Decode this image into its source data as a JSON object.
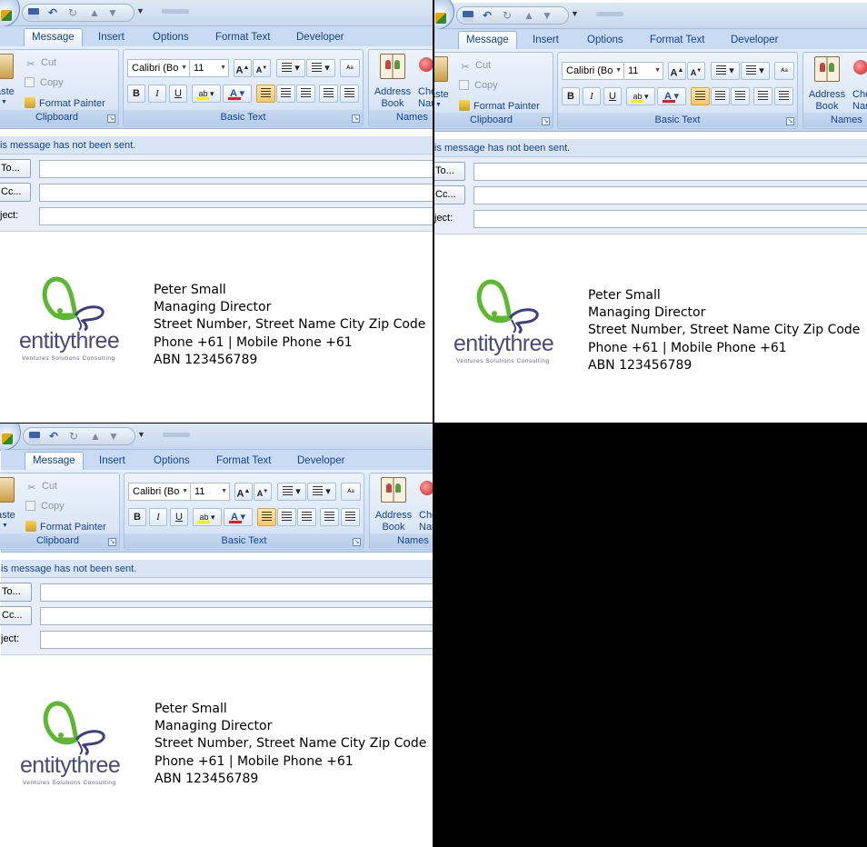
{
  "ribbon": {
    "tabs": [
      "Message",
      "Insert",
      "Options",
      "Format Text",
      "Developer"
    ],
    "active_tab": "Message",
    "clipboard": {
      "paste_label": "aste",
      "cut_label": "Cut",
      "copy_label": "Copy",
      "format_painter_label": "Format Painter",
      "group_label": "Clipboard"
    },
    "basic_text": {
      "font_value": "Calibri (Bo",
      "size_value": "11",
      "group_label": "Basic Text"
    },
    "names": {
      "address_book_line1": "Address",
      "address_book_line2": "Book",
      "check_names_line1": "Che",
      "check_names_line2": "Nam",
      "group_label": "Names"
    }
  },
  "message": {
    "info_bar": "is message has not been sent.",
    "to_button": "To...",
    "cc_button": "Cc...",
    "subject_label": "ject:"
  },
  "signature": {
    "logo_name": "entitythree",
    "logo_tagline": "Ventures Solutions Consulting",
    "lines": [
      "Peter Small",
      "Managing Director",
      "Street Number, Street Name City Zip Code",
      "Phone +61 | Mobile Phone +61",
      "ABN 123456789"
    ]
  },
  "colors": {
    "ribbon_text": "#15428b",
    "logo_green": "#5cb82e",
    "logo_purple": "#3f3f7f"
  }
}
